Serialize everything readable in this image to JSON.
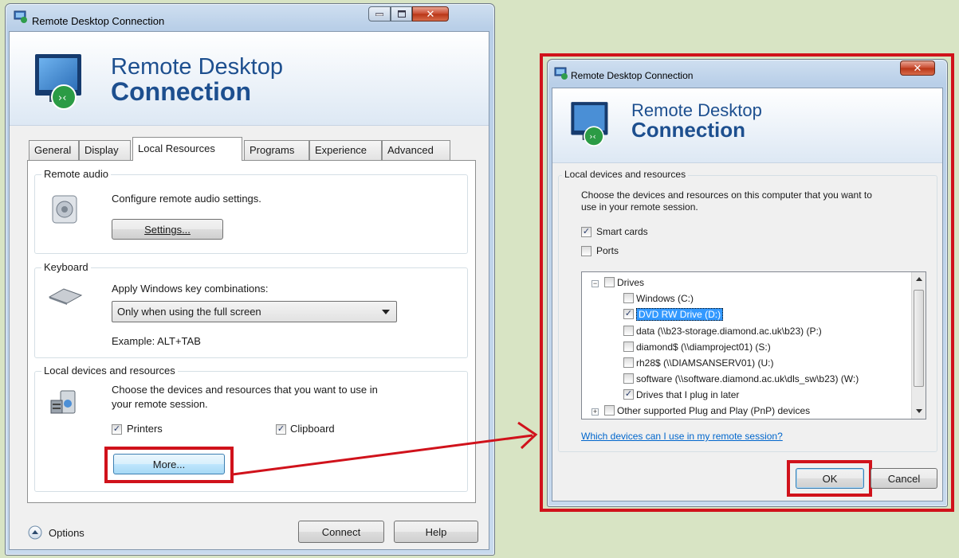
{
  "main_window": {
    "title": "Remote Desktop Connection",
    "banner_line1": "Remote Desktop",
    "banner_line2": "Connection",
    "tabs": [
      "General",
      "Display",
      "Local Resources",
      "Programs",
      "Experience",
      "Advanced"
    ],
    "active_tab": "Local Resources",
    "remote_audio": {
      "label": "Remote audio",
      "description": "Configure remote audio settings.",
      "settings_button": "Settings..."
    },
    "keyboard": {
      "label": "Keyboard",
      "description": "Apply Windows key combinations:",
      "selected_option": "Only when using the full screen",
      "example": "Example: ALT+TAB"
    },
    "local_devices": {
      "label": "Local devices and resources",
      "description_line1": "Choose the devices and resources that you want to use in",
      "description_line2": "your remote session.",
      "printers": {
        "label": "Printers",
        "checked": true
      },
      "clipboard": {
        "label": "Clipboard",
        "checked": true
      },
      "more_button": "More..."
    },
    "options_label": "Options",
    "connect_button": "Connect",
    "help_button": "Help"
  },
  "dialog": {
    "title": "Remote Desktop Connection",
    "banner_line1": "Remote Desktop",
    "banner_line2": "Connection",
    "group_label": "Local devices and resources",
    "description_line1": "Choose the devices and resources on this computer that you want to",
    "description_line2": "use in your remote session.",
    "smart_cards": {
      "label": "Smart cards",
      "checked": true
    },
    "ports": {
      "label": "Ports",
      "checked": false
    },
    "tree": {
      "drives_label": "Drives",
      "drives": [
        {
          "label": "Windows (C:)",
          "checked": false,
          "selected": false
        },
        {
          "label": "DVD RW Drive (D:)",
          "checked": true,
          "selected": true
        },
        {
          "label": "data (\\\\b23-storage.diamond.ac.uk\\b23) (P:)",
          "checked": false,
          "selected": false
        },
        {
          "label": "diamond$ (\\\\diamproject01) (S:)",
          "checked": false,
          "selected": false
        },
        {
          "label": "rh28$ (\\\\DIAMSANSERV01) (U:)",
          "checked": false,
          "selected": false
        },
        {
          "label": "software (\\\\software.diamond.ac.uk\\dls_sw\\b23) (W:)",
          "checked": false,
          "selected": false
        },
        {
          "label": "Drives that I plug in later",
          "checked": true,
          "selected": false
        }
      ],
      "other_label": "Other supported Plug and Play (PnP) devices"
    },
    "help_link": "Which devices can I use in my remote session?",
    "ok_button": "OK",
    "cancel_button": "Cancel"
  },
  "colors": {
    "highlight": "#d0121b",
    "arrow": "#d0121b",
    "selection": "#3399ff",
    "banner_text": "#1d4f8f"
  }
}
